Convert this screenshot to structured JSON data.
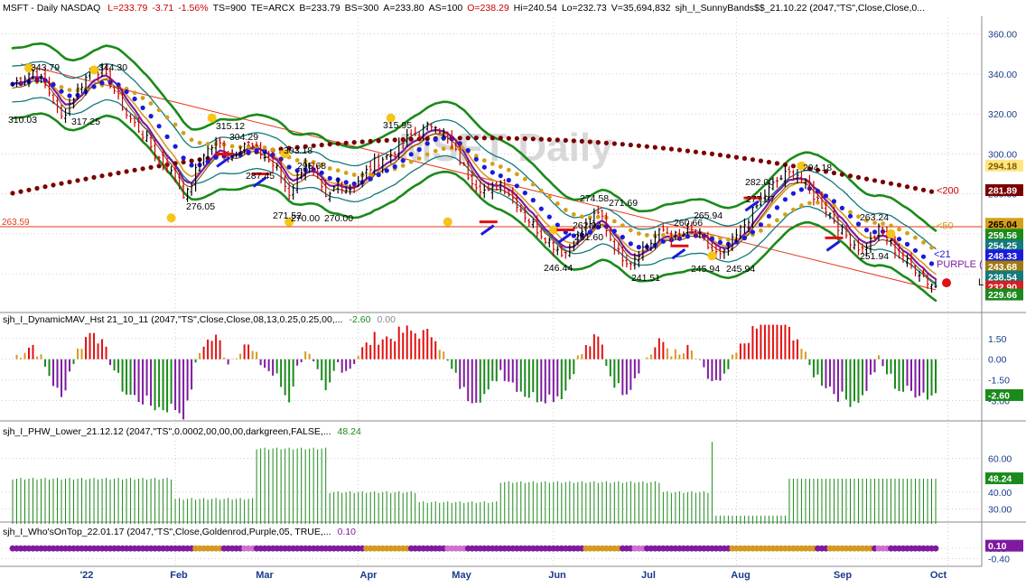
{
  "header": {
    "symbol": "MSFT - Daily  NASDAQ",
    "stats": [
      {
        "text": "L=233.79",
        "color": "#cc0000"
      },
      {
        "text": "-3.71",
        "color": "#cc0000"
      },
      {
        "text": "-1.56%",
        "color": "#cc0000"
      },
      {
        "text": "TS=900",
        "color": "#000000"
      },
      {
        "text": "TE=ARCX",
        "color": "#000000"
      },
      {
        "text": "B=233.79",
        "color": "#000000"
      },
      {
        "text": "BS=300",
        "color": "#000000"
      },
      {
        "text": "A=233.80",
        "color": "#000000"
      },
      {
        "text": "AS=100",
        "color": "#000000"
      },
      {
        "text": "O=238.29",
        "color": "#cc0000"
      },
      {
        "text": "Hi=240.54",
        "color": "#000000"
      },
      {
        "text": "Lo=232.73",
        "color": "#000000"
      },
      {
        "text": "V=35,694,832",
        "color": "#000000"
      },
      {
        "text": "sjh_I_SunnyBands$$_21.10.22 (2047,\"TS\",Close,Close,0...",
        "color": "#000000"
      }
    ]
  },
  "watermark": "MSFT Daily",
  "colors": {
    "up_bar": "#000000",
    "down_bar": "#cc0000",
    "ma200": "#7a0000",
    "ma50": "#d4a017",
    "ma21": "#1a1adc",
    "band_outer": "#1a8a1a",
    "band_inner": "#127a7a",
    "purple": "#7f1a9f",
    "goldenrod": "#d49a20",
    "green": "#1a8a1a",
    "axis_text": "#1a3a8a",
    "grid": "#b0b0b0"
  },
  "chart_data": [
    {
      "type": "candlestick",
      "name": "price",
      "y_range": [
        222,
        368
      ],
      "y_ticks": [
        "360.00",
        "340.00",
        "320.00",
        "300.00",
        "280.00",
        "260.00",
        "240.00"
      ],
      "x_labels": [
        "'22",
        "Feb",
        "Mar",
        "Apr",
        "May",
        "Jun",
        "Jul",
        "Aug",
        "Sep",
        "Oct"
      ],
      "support_level": {
        "value": 263.59,
        "label": "263.59",
        "color": "#e23a1a"
      },
      "trendline": {
        "from": [
          "Dec",
          345
        ],
        "to": [
          "Oct",
          232
        ]
      },
      "pivot_labels": [
        {
          "text": "343.79",
          "x": "Dec",
          "y": 344
        },
        {
          "text": "344.30",
          "x": "Dec",
          "y": 344.3
        },
        {
          "text": "310.03",
          "x": "Dec",
          "y": 316
        },
        {
          "text": "317.25",
          "x": "Jan",
          "y": 317.3
        },
        {
          "text": "315.12",
          "x": "Feb",
          "y": 315.1
        },
        {
          "text": "304.29",
          "x": "Feb",
          "y": 304.3
        },
        {
          "text": "276.05",
          "x": "Feb",
          "y": 276.1
        },
        {
          "text": "287.45",
          "x": "Feb",
          "y": 287.5
        },
        {
          "text": "303.18",
          "x": "Mar",
          "y": 303.2
        },
        {
          "text": "295.68",
          "x": "Mar",
          "y": 295.7
        },
        {
          "text": "271.52",
          "x": "Mar",
          "y": 271.5
        },
        {
          "text": "270.00",
          "x": "Mar",
          "y": 270
        },
        {
          "text": "270.00",
          "x": "Mar",
          "y": 270
        },
        {
          "text": "315.95",
          "x": "Apr",
          "y": 315.9
        },
        {
          "text": "274.58",
          "x": "Jun",
          "y": 274.6
        },
        {
          "text": "271.69",
          "x": "Jun",
          "y": 271.7
        },
        {
          "text": "262.94",
          "x": "Jun",
          "y": 262.9
        },
        {
          "text": "261.60",
          "x": "Jun",
          "y": 261.6
        },
        {
          "text": "246.44",
          "x": "May",
          "y": 246.4
        },
        {
          "text": "241.51",
          "x": "Jun",
          "y": 241.5
        },
        {
          "text": "260.66",
          "x": "Jul",
          "y": 260.7
        },
        {
          "text": "265.94",
          "x": "Jul",
          "y": 265.9
        },
        {
          "text": "245.94",
          "x": "Jul",
          "y": 245.9
        },
        {
          "text": "245.94",
          "x": "Jul",
          "y": 245.9
        },
        {
          "text": "282.00",
          "x": "Aug",
          "y": 282
        },
        {
          "text": "277.97",
          "x": "Aug",
          "y": 278
        },
        {
          "text": "294.18",
          "x": "Aug",
          "y": 294.2
        },
        {
          "text": "263.24",
          "x": "Sep",
          "y": 263.2
        },
        {
          "text": "251.94",
          "x": "Sep",
          "y": 251.9
        }
      ],
      "right_labels": [
        {
          "text": "<200",
          "color": "#cc0000",
          "y": 281.9
        },
        {
          "text": "<50",
          "color": "#d49a20",
          "y": 264.3
        },
        {
          "text": "<21",
          "color": "#1a1adc",
          "y": 250
        },
        {
          "text": "PURPLE (",
          "color": "#7f1a9f",
          "y": 245
        },
        {
          "text": "L",
          "color": "#000000",
          "y": 236
        }
      ],
      "value_tags": [
        {
          "text": "294.18",
          "bg": "#ffe680",
          "fg": "#7a5a00",
          "y": 294.18
        },
        {
          "text": "281.89",
          "bg": "#7a0000",
          "fg": "#ffffff",
          "y": 281.89
        },
        {
          "text": "265.04",
          "bg": "#d4a017",
          "fg": "#000000",
          "y": 265.04
        },
        {
          "text": "259.56",
          "bg": "#1a8a1a",
          "fg": "#ffffff",
          "y": 259.56
        },
        {
          "text": "254.25",
          "bg": "#127a7a",
          "fg": "#ffffff",
          "y": 254.25
        },
        {
          "text": "248.33",
          "bg": "#1a1adc",
          "fg": "#ffffff",
          "y": 249.2
        },
        {
          "text": "243.68",
          "bg": "#a07a10",
          "fg": "#ffffff",
          "y": 243.68
        },
        {
          "text": "238.54",
          "bg": "#127a7a",
          "fg": "#ffffff",
          "y": 238.6
        },
        {
          "text": "232.90",
          "bg": "#d42020",
          "fg": "#ffffff",
          "y": 233.6
        },
        {
          "text": "229.66",
          "bg": "#1a8a1a",
          "fg": "#ffffff",
          "y": 229.66
        }
      ],
      "current_price": 233.79
    },
    {
      "type": "bar",
      "name": "sjh_I_DynamicMAV_Hst",
      "title": "sjh_I_DynamicMAV_Hst 21_10_11 (2047,\"TS\",Close,Close,08,13,0.25,0.25,00,...",
      "values_text": [
        {
          "text": "-2.60",
          "color": "#1a8a1a"
        },
        {
          "text": "0.00",
          "color": "#888888"
        }
      ],
      "y_range": [
        -4.6,
        2.6
      ],
      "y_ticks": [
        "1.50",
        "0.00",
        "-1.50",
        "-3.00"
      ],
      "value_tag": {
        "text": "-2.60",
        "bg": "#1a8a1a",
        "fg": "#ffffff",
        "y": -2.6
      }
    },
    {
      "type": "bar",
      "name": "sjh_I_PHW_Lower",
      "title": "sjh_I_PHW_Lower_21.12.12 (2047,\"TS\",0.0002,00,00,00,darkgreen,FALSE,...",
      "values_text": [
        {
          "text": "48.24",
          "color": "#1a8a1a"
        }
      ],
      "y_range": [
        20,
        76
      ],
      "y_ticks": [
        "60.00",
        "40.00",
        "30.00"
      ],
      "value_tag": {
        "text": "48.24",
        "bg": "#1a8a1a",
        "fg": "#ffffff",
        "y": 48.24
      }
    },
    {
      "type": "dots",
      "name": "sjh_I_Who'sOnTop",
      "title": "sjh_I_Who'sOnTop_22.01.17 (2047,\"TS\",Close,Goldenrod,Purple,05, TRUE,...",
      "values_text": [
        {
          "text": "0.10",
          "color": "#7f1a9f"
        }
      ],
      "y_range": [
        -0.6,
        0.6
      ],
      "y_ticks": [
        "0.00",
        "-0.40"
      ],
      "value_tag": {
        "text": "0.10",
        "bg": "#7f1a9f",
        "fg": "#ffffff",
        "y": 0.1
      }
    }
  ]
}
